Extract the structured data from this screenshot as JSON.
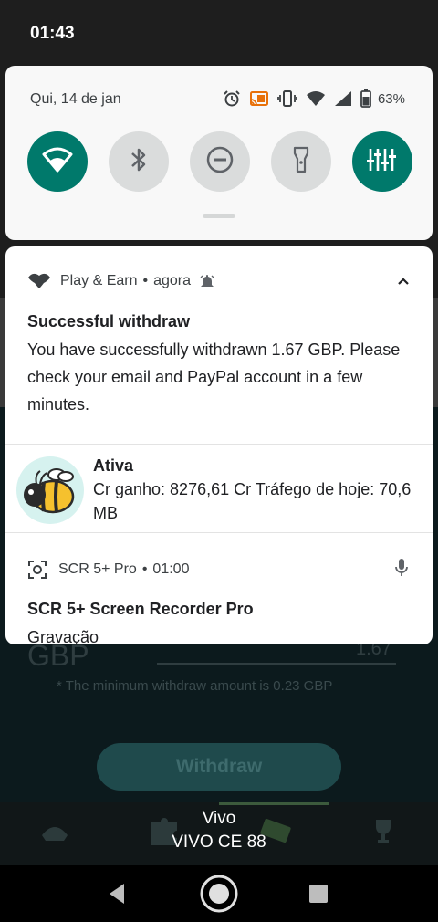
{
  "status_bar": {
    "time": "01:43"
  },
  "quick_settings": {
    "date": "Qui, 14 de jan",
    "battery": "63%",
    "tiles": [
      {
        "name": "wifi",
        "state": "on"
      },
      {
        "name": "bluetooth",
        "state": "off"
      },
      {
        "name": "do-not-disturb",
        "state": "off"
      },
      {
        "name": "flashlight",
        "state": "off"
      },
      {
        "name": "sound-equalizer",
        "state": "on"
      }
    ],
    "accent_color": "#00796b"
  },
  "notifications": [
    {
      "app": "Play & Earn",
      "time": "agora",
      "title": "Successful withdraw",
      "body": "You have successfully withdrawn 1.67 GBP. Please check your email and PayPal account in a few minutes."
    },
    {
      "title": "Ativa",
      "body": "Cr ganho: 8276,61 Cr Tráfego de hoje: 70,6 MB"
    },
    {
      "app": "SCR 5+ Pro",
      "time": "01:00",
      "title": "SCR 5+ Screen Recorder Pro",
      "body": "Gravação"
    }
  ],
  "background_app": {
    "partial_top_text": "1.67 GBP",
    "currency_label": "GBP",
    "amount_value": "1.67",
    "min_note": "* The minimum withdraw amount is 0.23 GBP",
    "withdraw_label": "Withdraw"
  },
  "carrier": {
    "name": "Vivo",
    "subtitle": "VIVO CE 88"
  }
}
